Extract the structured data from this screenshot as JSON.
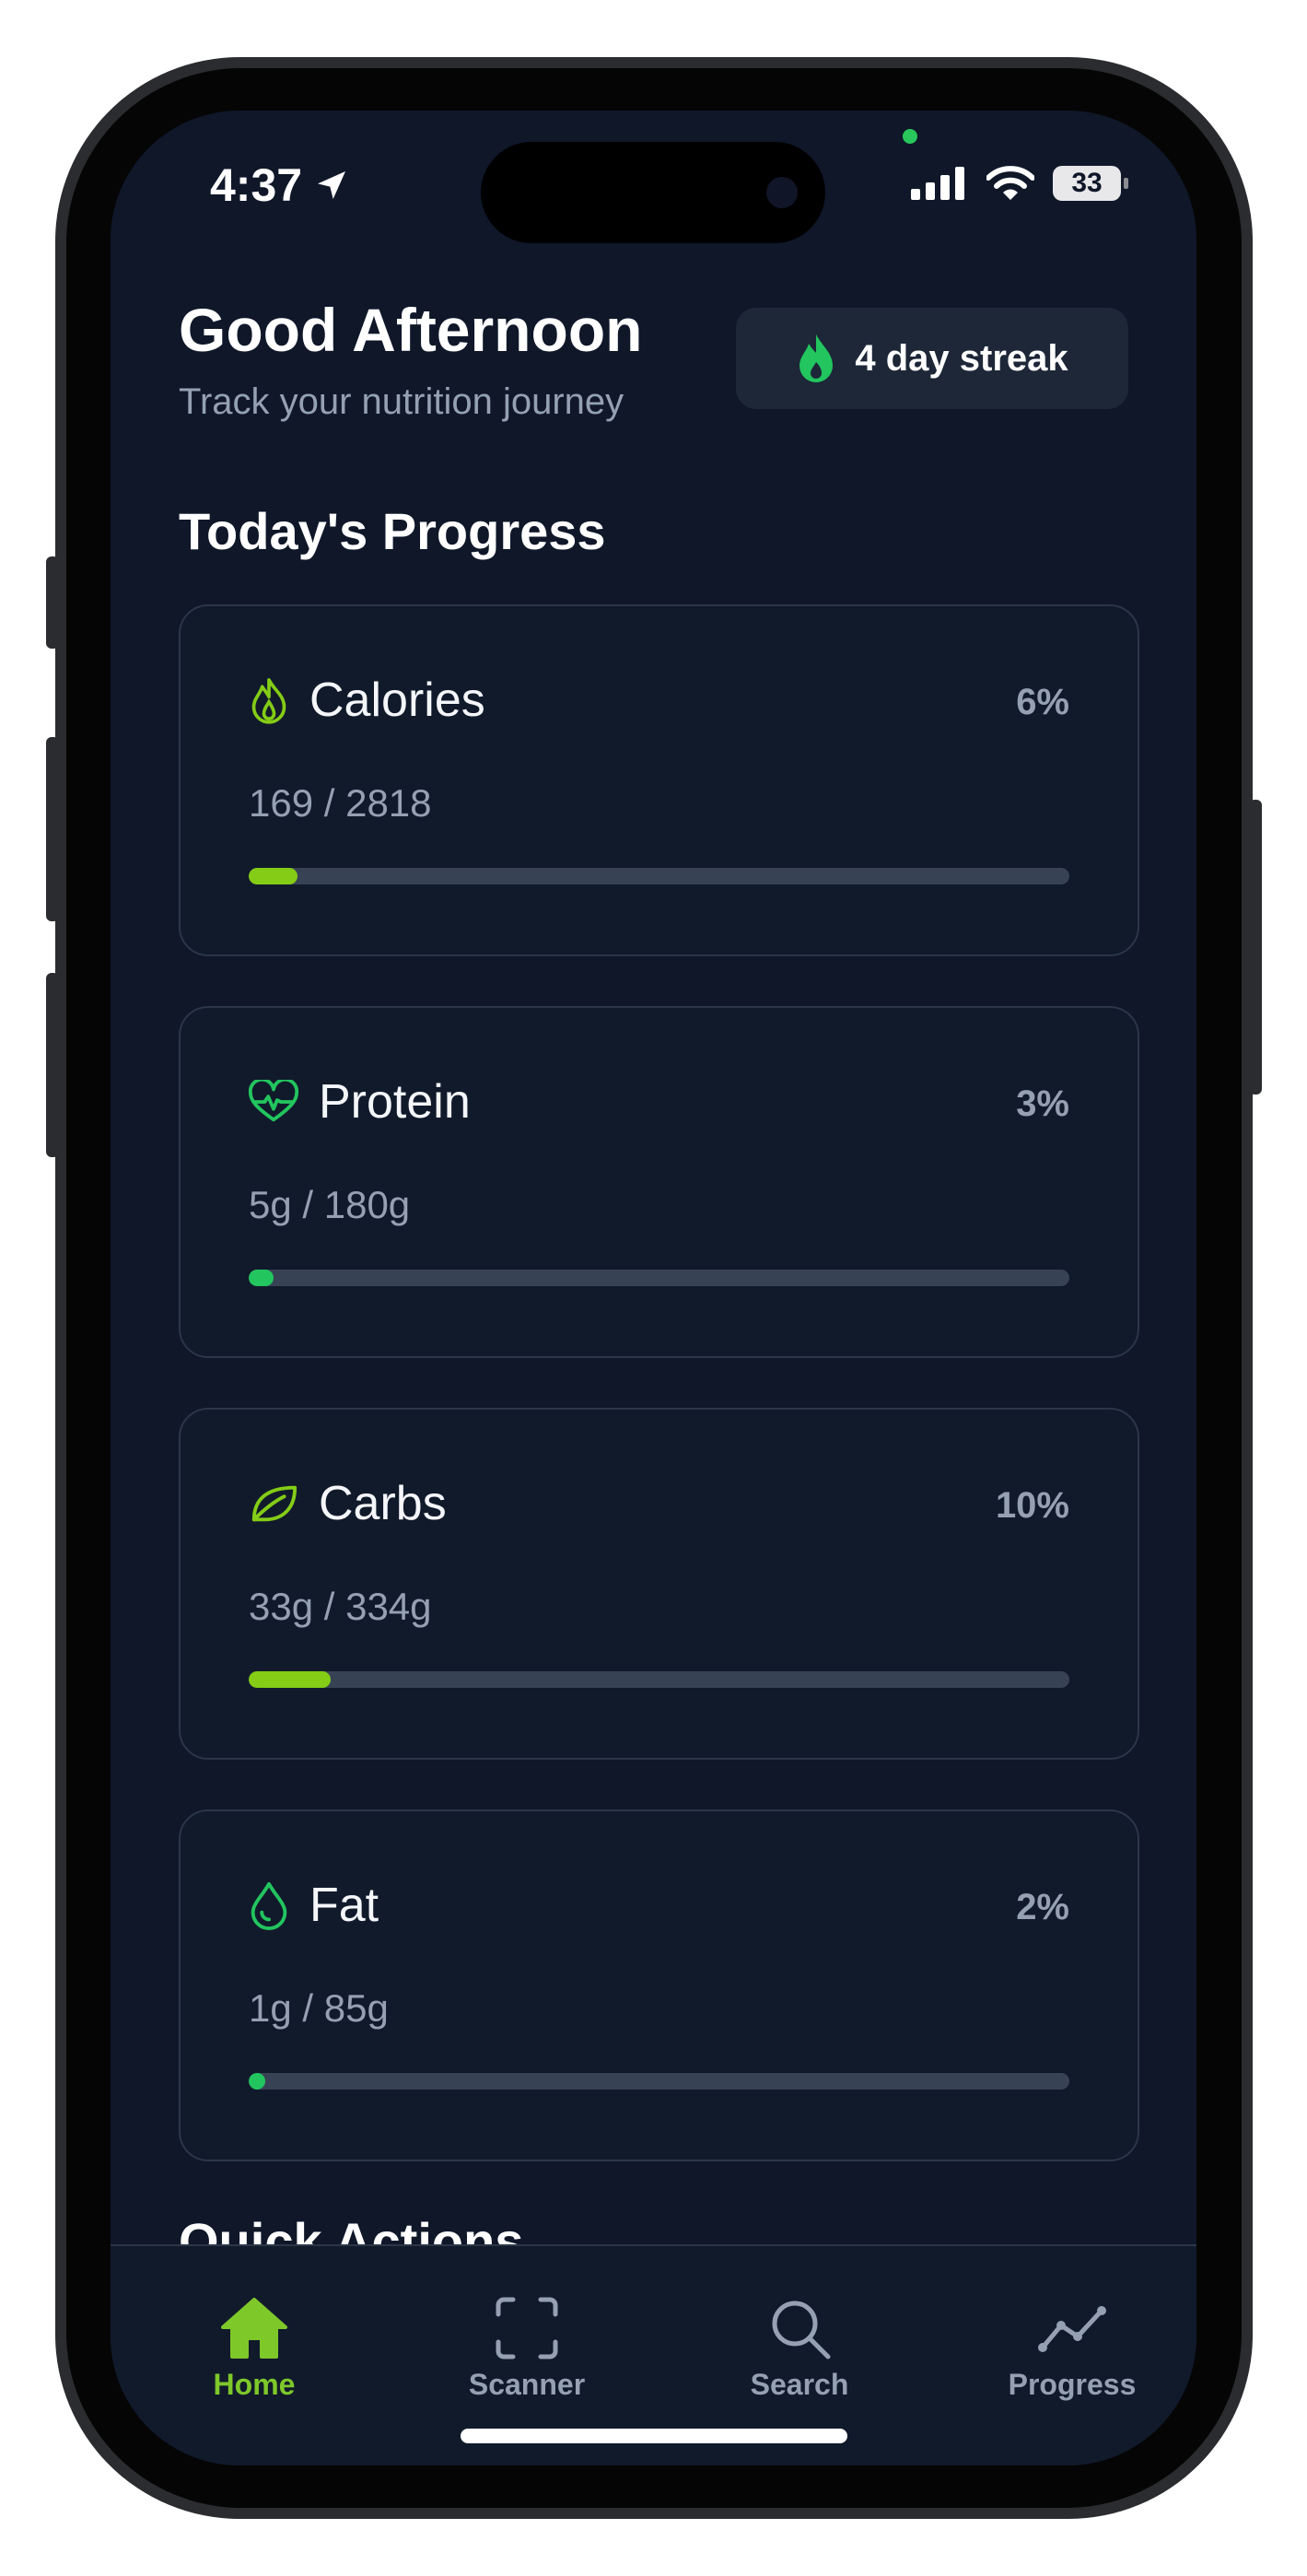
{
  "status_bar": {
    "time": "4:37",
    "battery": "33"
  },
  "header": {
    "greeting": "Good Afternoon",
    "subtitle": "Track your nutrition journey",
    "streak_label": "4 day streak"
  },
  "progress": {
    "title": "Today's Progress",
    "items": [
      {
        "name": "Calories",
        "amount": "169 / 2818",
        "percent_label": "6%",
        "fraction": 0.06,
        "color": "#84cc16",
        "icon": "flame-icon"
      },
      {
        "name": "Protein",
        "amount": "5g / 180g",
        "percent_label": "3%",
        "fraction": 0.03,
        "color": "#22c55e",
        "icon": "heart-pulse-icon"
      },
      {
        "name": "Carbs",
        "amount": "33g / 334g",
        "percent_label": "10%",
        "fraction": 0.1,
        "color": "#84cc16",
        "icon": "leaf-icon"
      },
      {
        "name": "Fat",
        "amount": "1g / 85g",
        "percent_label": "2%",
        "fraction": 0.02,
        "color": "#22c55e",
        "icon": "droplet-icon"
      }
    ]
  },
  "quick_actions": {
    "title": "Quick Actions"
  },
  "tabbar": {
    "tabs": [
      {
        "label": "Home",
        "icon": "home-icon",
        "active": true
      },
      {
        "label": "Scanner",
        "icon": "scan-icon",
        "active": false
      },
      {
        "label": "Search",
        "icon": "search-icon",
        "active": false
      },
      {
        "label": "Progress",
        "icon": "trend-icon",
        "active": false
      }
    ]
  },
  "colors": {
    "background": "#0f1729",
    "accent": "#84cc16",
    "accent_green": "#22c55e",
    "muted_text": "#95a0b3"
  }
}
